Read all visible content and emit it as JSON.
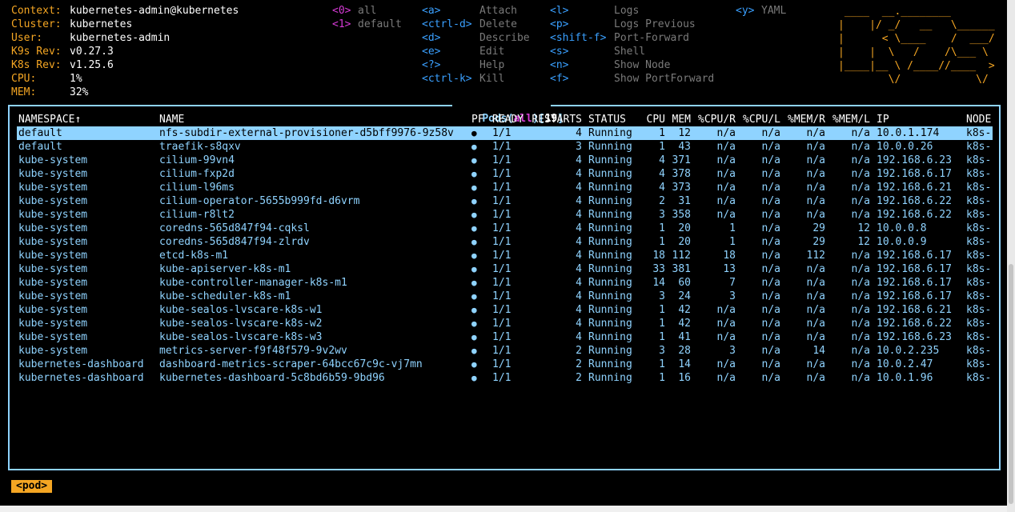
{
  "info": [
    {
      "label": "Context:",
      "value": "kubernetes-admin@kubernetes"
    },
    {
      "label": "Cluster:",
      "value": "kubernetes"
    },
    {
      "label": "User:",
      "value": "kubernetes-admin"
    },
    {
      "label": "K9s Rev:",
      "value": "v0.27.3"
    },
    {
      "label": "K8s Rev:",
      "value": "v1.25.6"
    },
    {
      "label": "CPU:",
      "value": "1%"
    },
    {
      "label": "MEM:",
      "value": "32%"
    }
  ],
  "namespace_shortcuts": [
    {
      "key": "<0>",
      "label": "all"
    },
    {
      "key": "<1>",
      "label": "default"
    }
  ],
  "hotkeys_col1": [
    {
      "key": "<a>",
      "label": "Attach"
    },
    {
      "key": "<ctrl-d>",
      "label": "Delete"
    },
    {
      "key": "<d>",
      "label": "Describe"
    },
    {
      "key": "<e>",
      "label": "Edit"
    },
    {
      "key": "<?>",
      "label": "Help"
    },
    {
      "key": "<ctrl-k>",
      "label": "Kill"
    }
  ],
  "hotkeys_col2": [
    {
      "key": "<l>",
      "label": "Logs"
    },
    {
      "key": "<p>",
      "label": "Logs Previous"
    },
    {
      "key": "<shift-f>",
      "label": "Port-Forward"
    },
    {
      "key": "<s>",
      "label": "Shell"
    },
    {
      "key": "<n>",
      "label": "Show Node"
    },
    {
      "key": "<f>",
      "label": "Show PortForward"
    }
  ],
  "hotkeys_col3": [
    {
      "key": "<y>",
      "label": "YAML"
    }
  ],
  "logo_art": [
    " ____  __.________        ",
    "|    |/ _/   __   \\______ ",
    "|      < \\____    /  ___/ ",
    "|    |  \\   /    /\\___ \\  ",
    "|____|__ \\ /____//____  > ",
    "        \\/            \\/  "
  ],
  "pane": {
    "resource": "Pods",
    "filter": "all",
    "count": "19"
  },
  "table": {
    "headers": [
      "NAMESPACE↑",
      "NAME",
      "PF",
      "READY",
      "RESTARTS",
      "STATUS",
      "CPU",
      "MEM",
      "%CPU/R",
      "%CPU/L",
      "%MEM/R",
      "%MEM/L",
      "IP",
      "NODE"
    ],
    "rows": [
      [
        "default",
        "nfs-subdir-external-provisioner-d5bff9976-9z58v",
        "●",
        "1/1",
        "4",
        "Running",
        "1",
        "12",
        "n/a",
        "n/a",
        "n/a",
        "n/a",
        "10.0.1.174",
        "k8s-"
      ],
      [
        "default",
        "traefik-s8qxv",
        "●",
        "1/1",
        "3",
        "Running",
        "1",
        "43",
        "n/a",
        "n/a",
        "n/a",
        "n/a",
        "10.0.0.26",
        "k8s-"
      ],
      [
        "kube-system",
        "cilium-99vn4",
        "●",
        "1/1",
        "4",
        "Running",
        "4",
        "371",
        "n/a",
        "n/a",
        "n/a",
        "n/a",
        "192.168.6.23",
        "k8s-"
      ],
      [
        "kube-system",
        "cilium-fxp2d",
        "●",
        "1/1",
        "4",
        "Running",
        "4",
        "378",
        "n/a",
        "n/a",
        "n/a",
        "n/a",
        "192.168.6.17",
        "k8s-"
      ],
      [
        "kube-system",
        "cilium-l96ms",
        "●",
        "1/1",
        "4",
        "Running",
        "4",
        "373",
        "n/a",
        "n/a",
        "n/a",
        "n/a",
        "192.168.6.21",
        "k8s-"
      ],
      [
        "kube-system",
        "cilium-operator-5655b999fd-d6vrm",
        "●",
        "1/1",
        "4",
        "Running",
        "2",
        "31",
        "n/a",
        "n/a",
        "n/a",
        "n/a",
        "192.168.6.22",
        "k8s-"
      ],
      [
        "kube-system",
        "cilium-r8lt2",
        "●",
        "1/1",
        "4",
        "Running",
        "3",
        "358",
        "n/a",
        "n/a",
        "n/a",
        "n/a",
        "192.168.6.22",
        "k8s-"
      ],
      [
        "kube-system",
        "coredns-565d847f94-cqksl",
        "●",
        "1/1",
        "4",
        "Running",
        "1",
        "20",
        "1",
        "n/a",
        "29",
        "12",
        "10.0.0.8",
        "k8s-"
      ],
      [
        "kube-system",
        "coredns-565d847f94-zlrdv",
        "●",
        "1/1",
        "4",
        "Running",
        "1",
        "20",
        "1",
        "n/a",
        "29",
        "12",
        "10.0.0.9",
        "k8s-"
      ],
      [
        "kube-system",
        "etcd-k8s-m1",
        "●",
        "1/1",
        "4",
        "Running",
        "18",
        "112",
        "18",
        "n/a",
        "112",
        "n/a",
        "192.168.6.17",
        "k8s-"
      ],
      [
        "kube-system",
        "kube-apiserver-k8s-m1",
        "●",
        "1/1",
        "4",
        "Running",
        "33",
        "381",
        "13",
        "n/a",
        "n/a",
        "n/a",
        "192.168.6.17",
        "k8s-"
      ],
      [
        "kube-system",
        "kube-controller-manager-k8s-m1",
        "●",
        "1/1",
        "4",
        "Running",
        "14",
        "60",
        "7",
        "n/a",
        "n/a",
        "n/a",
        "192.168.6.17",
        "k8s-"
      ],
      [
        "kube-system",
        "kube-scheduler-k8s-m1",
        "●",
        "1/1",
        "4",
        "Running",
        "3",
        "24",
        "3",
        "n/a",
        "n/a",
        "n/a",
        "192.168.6.17",
        "k8s-"
      ],
      [
        "kube-system",
        "kube-sealos-lvscare-k8s-w1",
        "●",
        "1/1",
        "4",
        "Running",
        "1",
        "42",
        "n/a",
        "n/a",
        "n/a",
        "n/a",
        "192.168.6.21",
        "k8s-"
      ],
      [
        "kube-system",
        "kube-sealos-lvscare-k8s-w2",
        "●",
        "1/1",
        "4",
        "Running",
        "1",
        "42",
        "n/a",
        "n/a",
        "n/a",
        "n/a",
        "192.168.6.22",
        "k8s-"
      ],
      [
        "kube-system",
        "kube-sealos-lvscare-k8s-w3",
        "●",
        "1/1",
        "4",
        "Running",
        "1",
        "41",
        "n/a",
        "n/a",
        "n/a",
        "n/a",
        "192.168.6.23",
        "k8s-"
      ],
      [
        "kube-system",
        "metrics-server-f9f48f579-9v2wv",
        "●",
        "1/1",
        "2",
        "Running",
        "3",
        "28",
        "3",
        "n/a",
        "14",
        "n/a",
        "10.0.2.235",
        "k8s-"
      ],
      [
        "kubernetes-dashboard",
        "dashboard-metrics-scraper-64bcc67c9c-vj7mn",
        "●",
        "1/1",
        "2",
        "Running",
        "1",
        "14",
        "n/a",
        "n/a",
        "n/a",
        "n/a",
        "10.0.2.47",
        "k8s-"
      ],
      [
        "kubernetes-dashboard",
        "kubernetes-dashboard-5c8bd6b59-9bd96",
        "●",
        "1/1",
        "2",
        "Running",
        "1",
        "16",
        "n/a",
        "n/a",
        "n/a",
        "n/a",
        "10.0.1.96",
        "k8s-"
      ]
    ],
    "selected_row": 0
  },
  "breadcrumb": "<pod>",
  "colors": {
    "accent_orange": "#f5a623",
    "table_cyan": "#8fd3ff",
    "hotkey_blue": "#3aa0ff",
    "namespace_magenta": "#d63ad6",
    "disabled_gray": "#7a7a7a"
  }
}
